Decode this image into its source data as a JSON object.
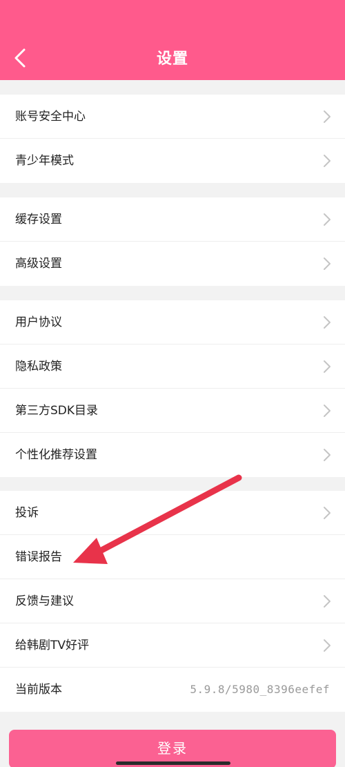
{
  "header": {
    "title": "设置",
    "back_icon": "chevron-left-icon",
    "bg_color": "#ff5a8c"
  },
  "groups": [
    {
      "items": [
        {
          "label": "账号安全中心"
        },
        {
          "label": "青少年模式"
        }
      ]
    },
    {
      "items": [
        {
          "label": "缓存设置"
        },
        {
          "label": "高级设置"
        }
      ]
    },
    {
      "items": [
        {
          "label": "用户协议"
        },
        {
          "label": "隐私政策"
        },
        {
          "label": "第三方SDK目录"
        },
        {
          "label": "个性化推荐设置"
        }
      ]
    },
    {
      "items": [
        {
          "label": "投诉"
        },
        {
          "label": "错误报告"
        },
        {
          "label": "反馈与建议"
        },
        {
          "label": "给韩剧TV好评"
        },
        {
          "label": "当前版本",
          "value": "5.9.8/5980_8396eefef"
        }
      ]
    }
  ],
  "login_button": {
    "label": "登录",
    "color": "#fb6192"
  },
  "annotation": {
    "arrow_icon": "red-arrow-icon",
    "color": "#e8334a"
  }
}
